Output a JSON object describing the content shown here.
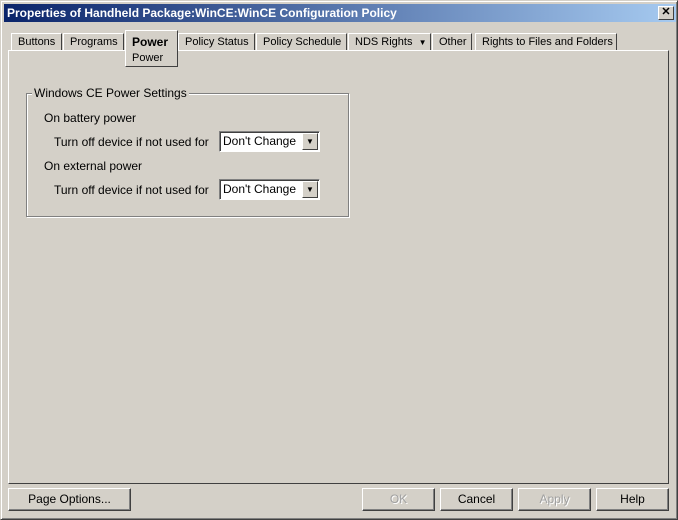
{
  "window": {
    "title": "Properties of Handheld Package:WinCE:WinCE Configuration Policy",
    "close": "✕"
  },
  "tabs": [
    {
      "label": "Buttons"
    },
    {
      "label": "Programs"
    },
    {
      "label": "Power",
      "subtab": "Power"
    },
    {
      "label": "Policy Status"
    },
    {
      "label": "Policy Schedule"
    },
    {
      "label": "NDS Rights",
      "dropdown": "▼"
    },
    {
      "label": "Other"
    },
    {
      "label": "Rights to Files and Folders"
    }
  ],
  "group": {
    "title": "Windows CE Power Settings",
    "battery": {
      "heading": "On battery power",
      "label": "Turn off device if not used for",
      "value": "Don't Change"
    },
    "external": {
      "heading": "On external power",
      "label": "Turn off device if not used for",
      "value": "Don't Change"
    }
  },
  "buttons": {
    "page_options": "Page Options...",
    "ok": "OK",
    "cancel": "Cancel",
    "apply": "Apply",
    "help": "Help"
  }
}
